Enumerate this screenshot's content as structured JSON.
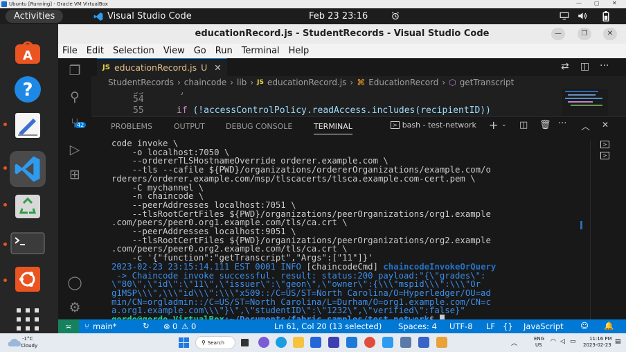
{
  "vbox": {
    "title": "Ubuntu [Running] - Oracle VM VirtualBox",
    "min": "—",
    "max": "▢",
    "close": "✕"
  },
  "topbar": {
    "activities": "Activities",
    "app_name": "Visual Studio Code",
    "clock": "Feb 23  23:16"
  },
  "window": {
    "title": "educationRecord.js - StudentRecords - Visual Studio Code"
  },
  "menu": [
    "File",
    "Edit",
    "Selection",
    "View",
    "Go",
    "Run",
    "Terminal",
    "Help"
  ],
  "tab": {
    "icon": "JS",
    "name": "educationRecord.js",
    "modified": "U"
  },
  "breadcrumb": {
    "p0": "StudentRecords",
    "p1": "chaincode",
    "p2": "lib",
    "p3_icon": "JS",
    "p3": "educationRecord.js",
    "p4": "EducationRecord",
    "p5": "getTranscript"
  },
  "code": {
    "l54": "54",
    "l55": "55",
    "l55_if": "if",
    "l55_text": " (!accessControlPolicy.readAccess.includes(recipientID))"
  },
  "source_control_badge": "42",
  "panel": {
    "tabs": [
      "PROBLEMS",
      "OUTPUT",
      "DEBUG CONSOLE",
      "TERMINAL"
    ],
    "terminal_name": "bash - test-network"
  },
  "terminal": {
    "lines": [
      "code invoke \\",
      "    -o localhost:7050 \\",
      "    --ordererTLSHostnameOverride orderer.example.com \\",
      "    --tls --cafile ${PWD}/organizations/ordererOrganizations/example.com/o",
      "rderers/orderer.example.com/msp/tlscacerts/tlsca.example.com-cert.pem \\",
      "    -C mychannel \\",
      "    -n chaincode \\",
      "    --peerAddresses localhost:7051 \\",
      "    --tlsRootCertFiles ${PWD}/organizations/peerOrganizations/org1.example",
      ".com/peers/peer0.org1.example.com/tls/ca.crt \\",
      "    --peerAddresses localhost:9051 \\",
      "    --tlsRootCertFiles ${PWD}/organizations/peerOrganizations/org2.example",
      ".com/peers/peer0.org2.example.com/tls/ca.crt \\",
      "    -c '{\"function\":\"getTranscript\",\"Args\":[\"11\"]}'"
    ],
    "log_ts": "2023-02-23 23:15:14.111 EST 0001 INFO",
    "log_tag": " [chaincodeCmd] ",
    "log_fn": "chaincodeInvokeOrQuery",
    "result_lines": [
      " -> Chaincode invoke successful. result: status:200 payload:\"{\\\"grades\\\":",
      "\\\"80\\\",\\\"id\\\":\\\"11\\\",\\\"issuer\\\":\\\"geon\\\",\\\"owner\\\":{\\\\\\\"mspid\\\\\\\":\\\\\\\"Or",
      "g1MSP\\\\\\\",\\\\\\\"id\\\\\\\":\\\\\\\"x509::/C=US/ST=North Carolina/O=Hyperledger/OU=ad",
      "min/CN=orgladmin::/C=US/ST=North Carolina/L=Durham/O=org1.example.com/CN=c",
      "a.org1.example.com\\\\\\\"}\\\",\\\"studentID\\\":\\\"1232\\\",\\\"verified\\\":false}\""
    ],
    "prompt_user": "gordo@gordo-VirtualBox",
    "prompt_path": ":~/Documents/fabric-samples/test-network",
    "prompt_end": "$ "
  },
  "status": {
    "branch": "main*",
    "errors": "0",
    "warnings": "0",
    "position": "Ln 61, Col 20 (13 selected)",
    "spaces": "Spaces: 4",
    "encoding": "UTF-8",
    "eol": "LF",
    "lang": "JavaScript"
  },
  "taskbar": {
    "temp": "-1°C",
    "weather": "Cloudy",
    "search": "Search",
    "lang1": "ENG",
    "lang2": "US",
    "time": "11:16 PM",
    "date": "2023-02-23"
  },
  "colors": {
    "accent": "#0078d4",
    "ubuntu_orange": "#e95420",
    "status_bar": "#0078d4"
  }
}
